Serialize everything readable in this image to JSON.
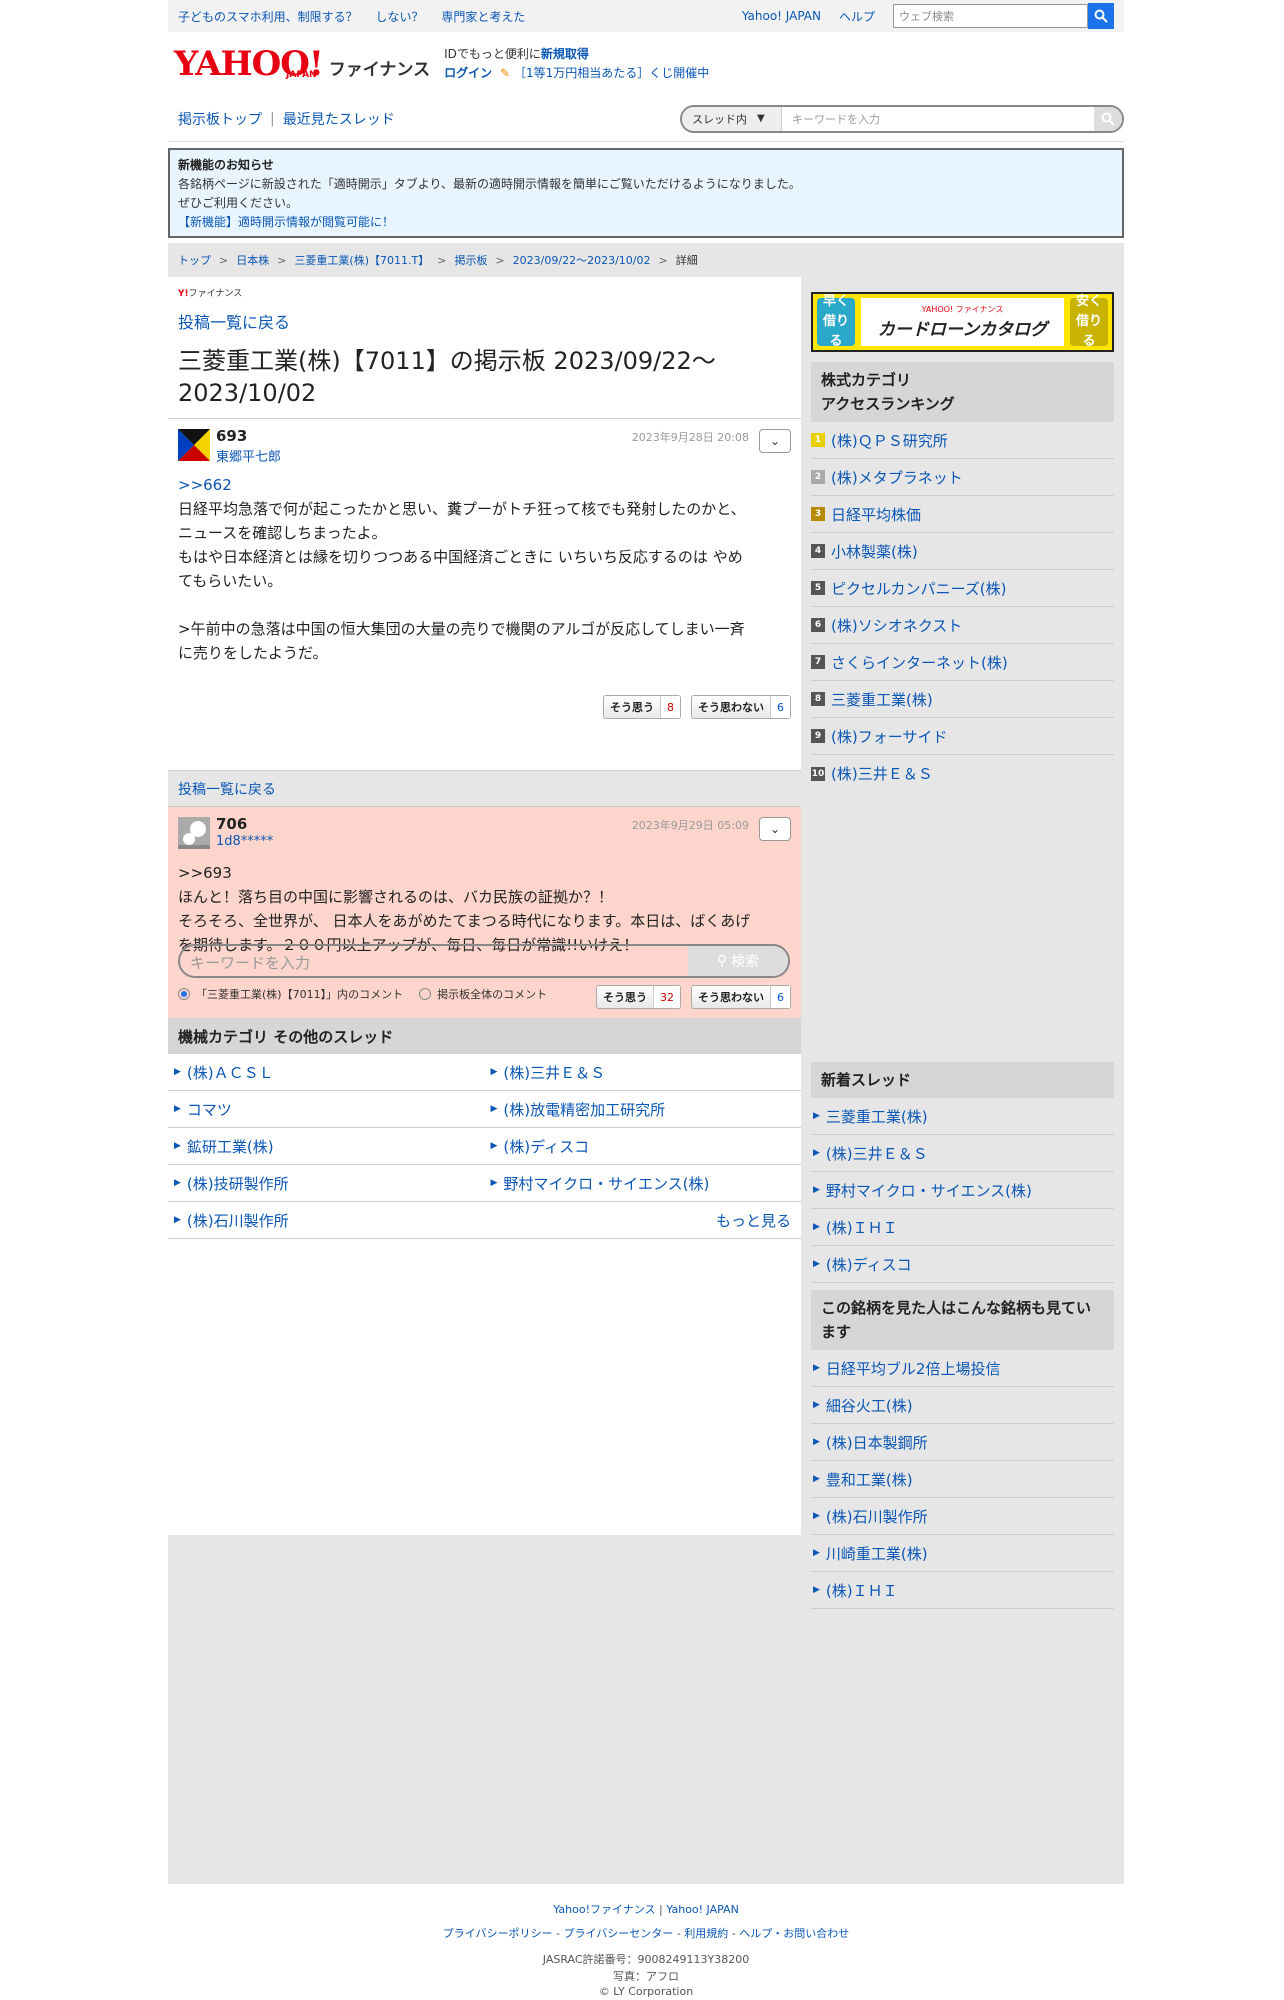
{
  "topbar": {
    "links": [
      "子どものスマホ利用、制限する？",
      "しない？",
      "専門家と考えた"
    ],
    "yahoo_japan": "Yahoo! JAPAN",
    "help": "ヘルプ",
    "search_placeholder": "ウェブ検索"
  },
  "header": {
    "logo_text": "YAHOO!",
    "logo_sub": "JAPAN",
    "logo_finance": "ファイナンス",
    "promo_line1_prefix": "IDでもっと便利に",
    "promo_line1_link": "新規取得",
    "promo_login": "ログイン",
    "promo_line2": "［1等1万円相当あたる］くじ開催中"
  },
  "nav": {
    "items": [
      "掲示板トップ",
      "最近見たスレッド"
    ],
    "scope": "スレッド内",
    "search_placeholder": "キーワードを入力"
  },
  "notice": {
    "title": "新機能のお知らせ",
    "line1": "各銘柄ページに新設された「適時開示」タブより、最新の適時開示情報を簡単にご覧いただけるようになりました。",
    "line2": "ぜひご利用ください。",
    "link": "【新機能】適時開示情報が閲覧可能に！"
  },
  "breadcrumb": [
    "トップ",
    "日本株",
    "三菱重工業(株)【7011.T】",
    "掲示板",
    "2023/09/22〜2023/10/02",
    "詳細"
  ],
  "main": {
    "yf_small": "ファイナンス",
    "back_label": "投稿一覧に戻る",
    "title": "三菱重工業(株)【7011】の掲示板 2023/09/22〜2023/10/02"
  },
  "posts": [
    {
      "num": "693",
      "user": "東郷平七郎",
      "date": "2023年9月28日 20:08",
      "reply_to": ">>662",
      "lines": [
        "日経平均急落で何が起こったかと思い、糞プーがトチ狂って核でも発射したのかと、",
        "ニュースを確認しちまったよ。",
        "もはや日本経済とは縁を切りつつある中国経済ごときに いちいち反応するのは やめ",
        "てもらいたい。",
        "",
        ">午前中の急落は中国の恒大集団の大量の売りで機関のアルゴが反応してしまい一斉",
        "に売りをしたようだ。"
      ],
      "agree_label": "そう思う",
      "agree_count": "8",
      "disagree_label": "そう思わない",
      "disagree_count": "6"
    },
    {
      "num": "706",
      "user": "1d8*****",
      "date": "2023年9月29日 05:09",
      "reply_to": ">>693",
      "lines": [
        "ほんと！落ち目の中国に影響されるのは、バカ民族の証拠か？！",
        "そろそろ、全世界が、 日本人をあがめたてまつる時代になります。本日は、ばくあげ",
        "を期待します。２００円以上アップが、毎日、毎日が常識!!いけえ！"
      ],
      "agree_label": "そう思う",
      "agree_count": "32",
      "disagree_label": "そう思わない",
      "disagree_count": "6"
    }
  ],
  "bottom_search": {
    "placeholder": "キーワードを入力",
    "button": "検索",
    "radio1": "「三菱重工業(株)【7011】」内のコメント",
    "radio2": "掲示板全体のコメント"
  },
  "other_threads": {
    "title": "機械カテゴリ その他のスレッド",
    "items": [
      "(株)ＡＣＳＬ",
      "(株)三井Ｅ＆Ｓ",
      "コマツ",
      "(株)放電精密加工研究所",
      "鉱研工業(株)",
      "(株)ディスコ",
      "(株)技研製作所",
      "野村マイクロ・サイエンス(株)",
      "(株)石川製作所"
    ],
    "more": "もっと見る"
  },
  "ad": {
    "left": "早く借りる",
    "brand": "YAHOO! ファイナンス",
    "title": "カードローンカタログ",
    "right": "安く借りる"
  },
  "ranking": {
    "title_line1": "株式カテゴリ",
    "title_line2": "アクセスランキング",
    "items": [
      {
        "rank": "1",
        "name": "(株)ＱＰＳ研究所"
      },
      {
        "rank": "2",
        "name": "(株)メタプラネット"
      },
      {
        "rank": "3",
        "name": "日経平均株価"
      },
      {
        "rank": "4",
        "name": "小林製薬(株)"
      },
      {
        "rank": "5",
        "name": "ピクセルカンパニーズ(株)"
      },
      {
        "rank": "6",
        "name": "(株)ソシオネクスト"
      },
      {
        "rank": "7",
        "name": "さくらインターネット(株)"
      },
      {
        "rank": "8",
        "name": "三菱重工業(株)"
      },
      {
        "rank": "9",
        "name": "(株)フォーサイド"
      },
      {
        "rank": "10",
        "name": "(株)三井Ｅ＆Ｓ"
      }
    ]
  },
  "new_threads": {
    "title": "新着スレッド",
    "items": [
      "三菱重工業(株)",
      "(株)三井Ｅ＆Ｓ",
      "野村マイクロ・サイエンス(株)",
      "(株)ＩＨＩ",
      "(株)ディスコ"
    ]
  },
  "also_viewed": {
    "title": "この銘柄を見た人はこんな銘柄も見ています",
    "items": [
      "日経平均ブル2倍上場投信",
      "細谷火工(株)",
      "(株)日本製鋼所",
      "豊和工業(株)",
      "(株)石川製作所",
      "川崎重工業(株)",
      "(株)ＩＨＩ"
    ]
  },
  "footer": {
    "row1": [
      "Yahoo!ファイナンス",
      "Yahoo! JAPAN"
    ],
    "row2": [
      "プライバシーポリシー",
      "プライバシーセンター",
      "利用規約",
      "ヘルプ・お問い合わせ"
    ],
    "jasrac": "JASRAC許諾番号：9008249113Y38200",
    "photo": "写真：アフロ",
    "copyright": "© LY Corporation"
  }
}
